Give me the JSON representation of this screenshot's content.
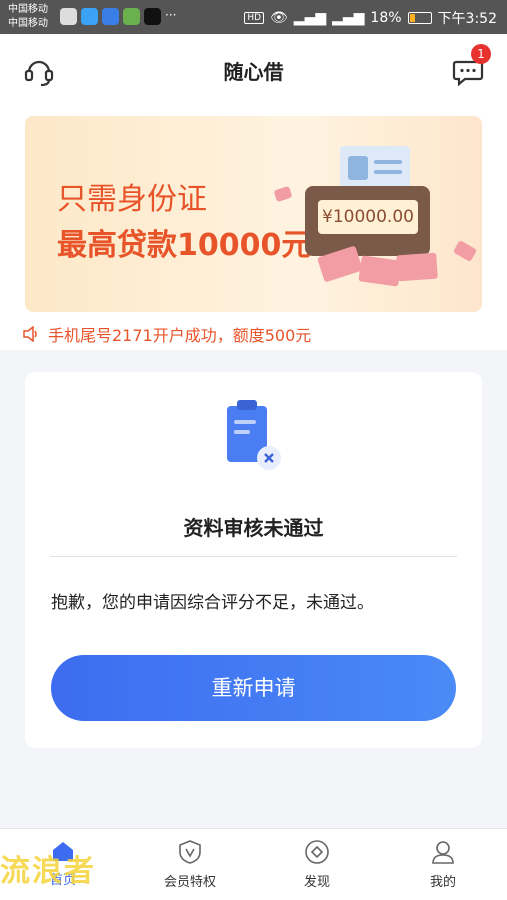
{
  "status_bar": {
    "carrier_1": "中国移动",
    "carrier_2": "中国移动",
    "hd": "HD",
    "battery": "18%",
    "time": "下午3:52"
  },
  "header": {
    "title": "随心借",
    "message_badge": "1",
    "left_icon": "customer-service-icon",
    "right_icon": "message-icon"
  },
  "banner": {
    "line1": "只需身份证",
    "line2": "最高贷款10000元",
    "amount": "¥10000.00"
  },
  "notice": {
    "icon": "speaker-icon",
    "text": "手机尾号2171开户成功，额度500元"
  },
  "result": {
    "icon": "clipboard-rejected-icon",
    "title": "资料审核未通过",
    "message": "抱歉，您的申请因综合评分不足，未通过。",
    "button": "重新申请"
  },
  "tabbar": {
    "tabs": [
      {
        "label": "首页",
        "icon": "home-icon"
      },
      {
        "label": "会员特权",
        "icon": "vip-shield-icon"
      },
      {
        "label": "发现",
        "icon": "discover-icon"
      },
      {
        "label": "我的",
        "icon": "user-icon"
      }
    ]
  },
  "watermark": "流浪者",
  "colors": {
    "accent": "#3d6cf0",
    "banner_text": "#e8542a",
    "badge": "#e8322e"
  }
}
